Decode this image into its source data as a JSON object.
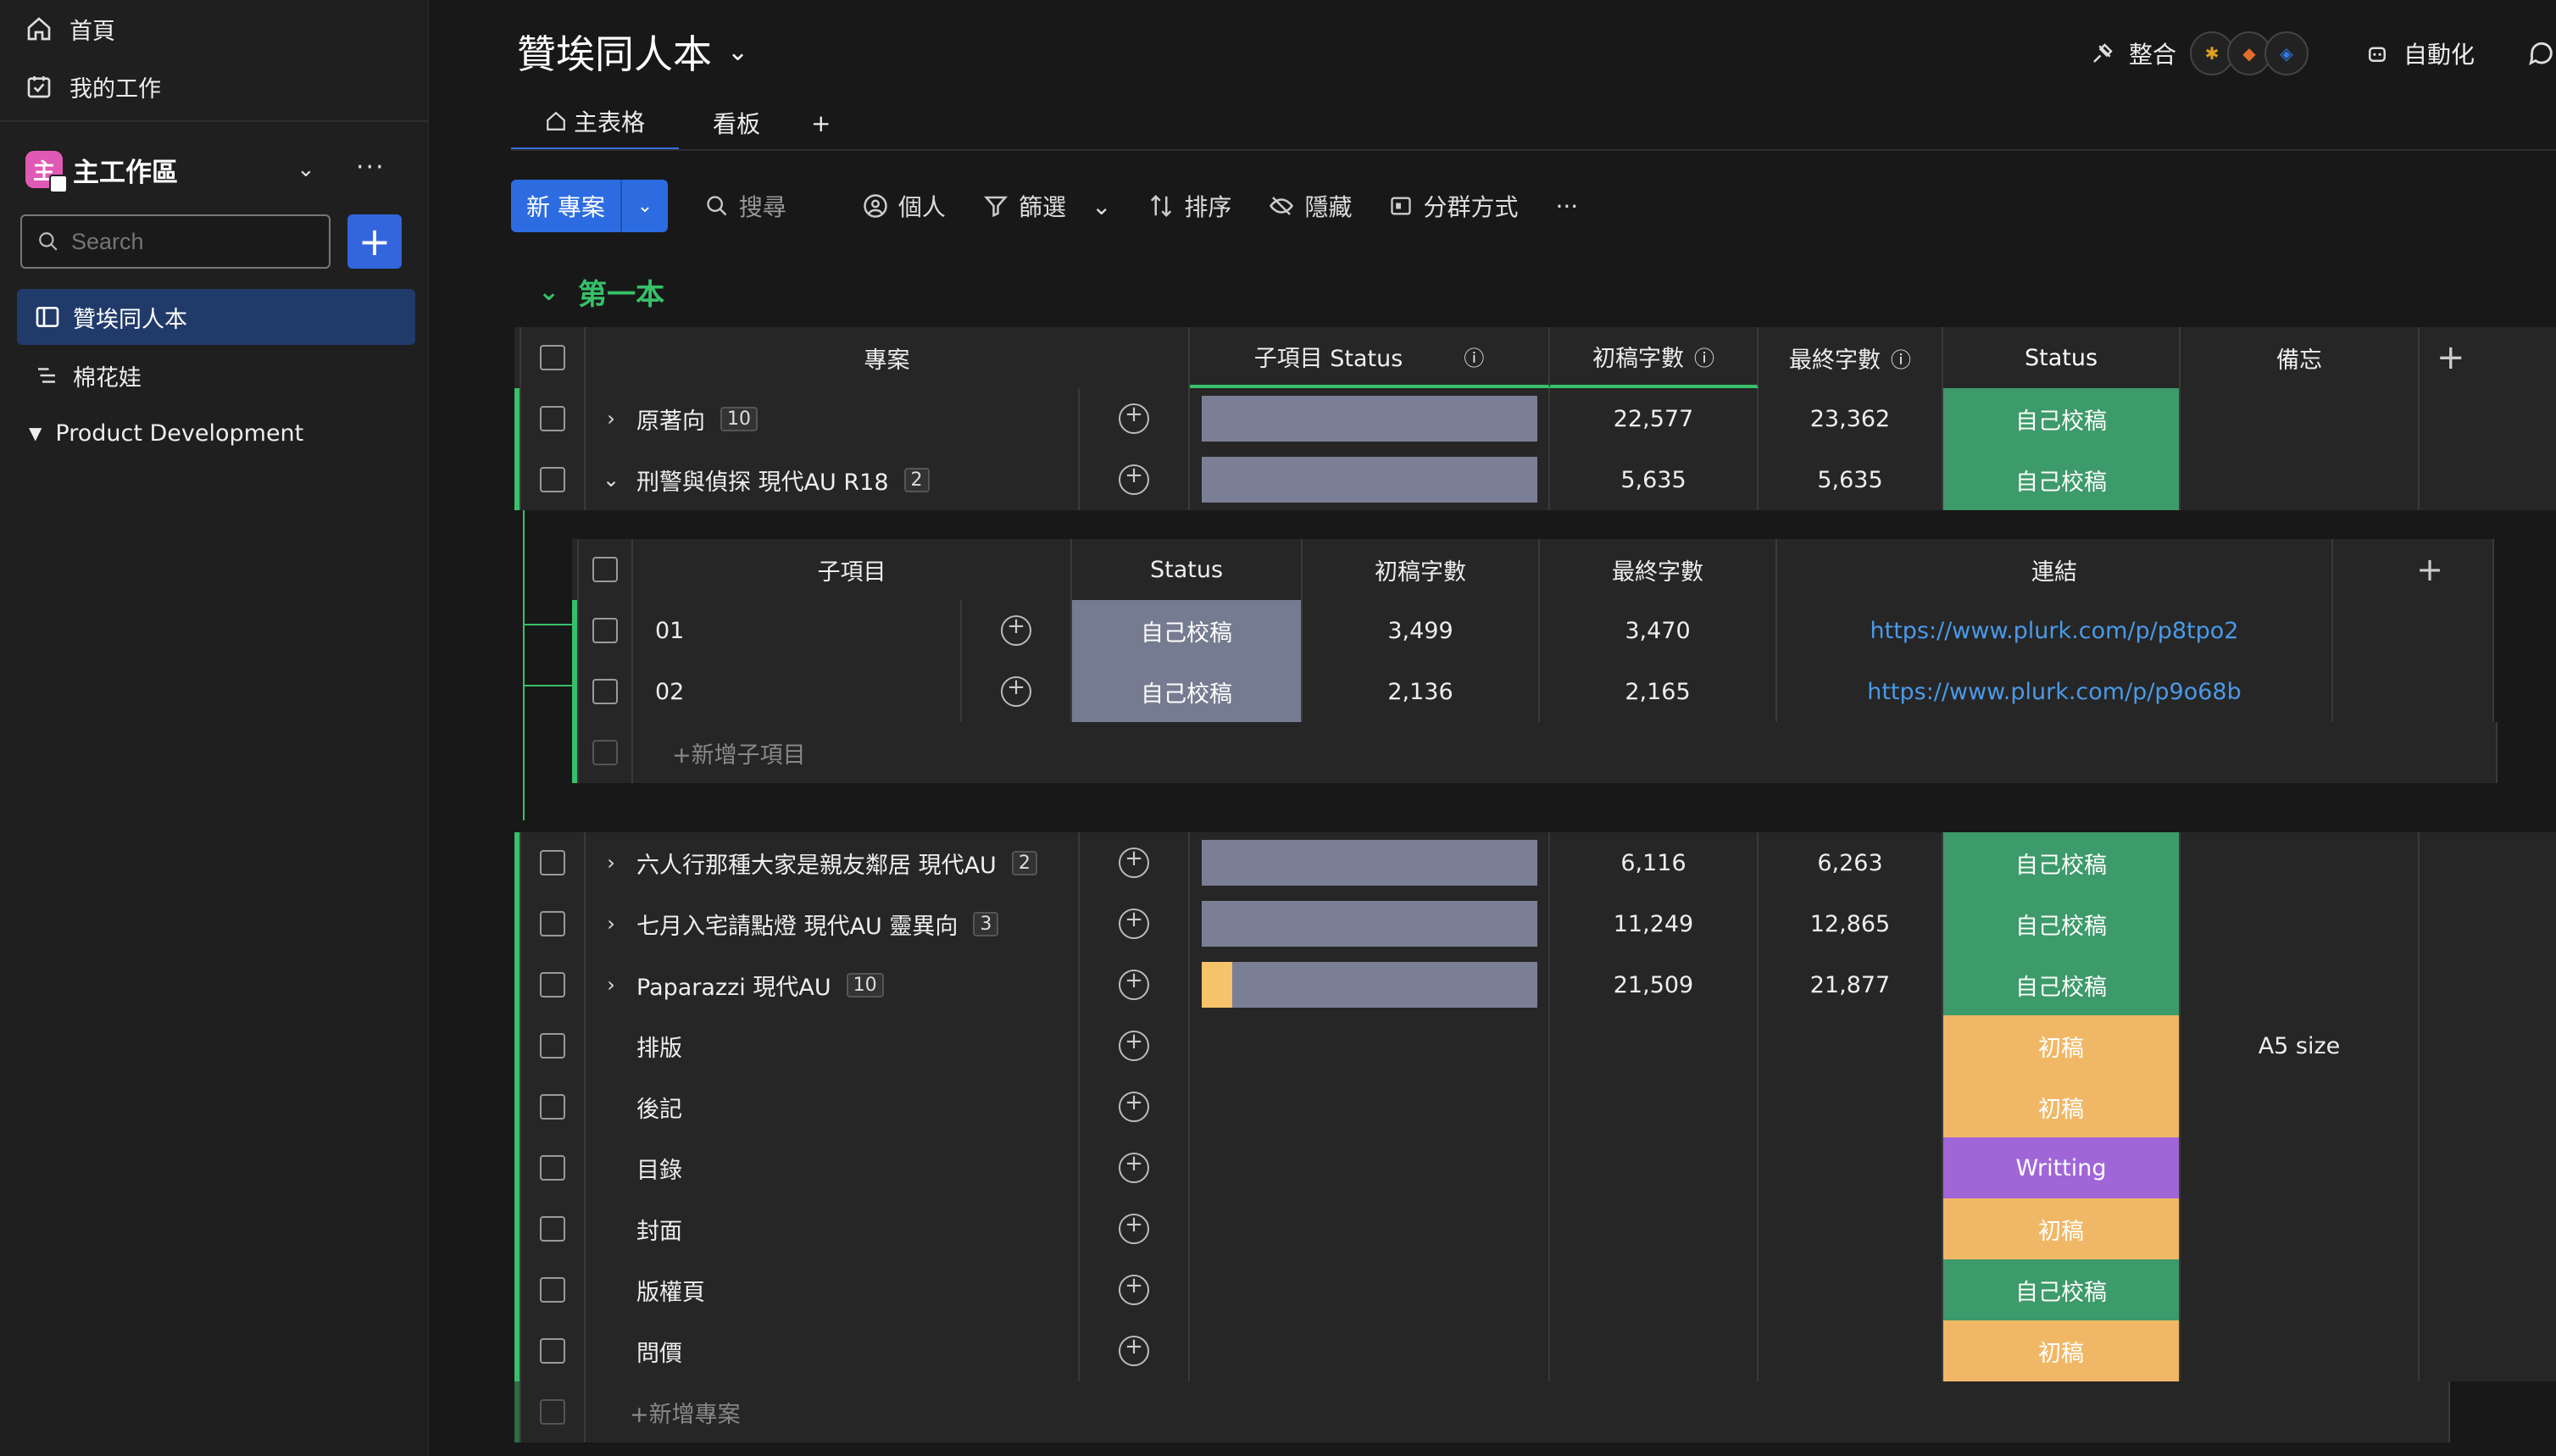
{
  "sidebar": {
    "home": "首頁",
    "my_work": "我的工作",
    "workspace_name": "主工作區",
    "workspace_logo": "主",
    "search_placeholder": "Search",
    "boards": [
      {
        "label": "贊埃同人本",
        "icon": "board-icon"
      },
      {
        "label": "棉花娃",
        "icon": "list-icon"
      },
      {
        "label": "Product Development",
        "icon": "caret-icon"
      }
    ]
  },
  "header": {
    "title": "贊埃同人本",
    "integrate": "整合",
    "automate": "自動化",
    "tabs": [
      {
        "label": "主表格"
      },
      {
        "label": "看板"
      },
      {
        "label": "+"
      }
    ]
  },
  "toolbar": {
    "new_project": "新 專案",
    "search": "搜尋",
    "person": "個人",
    "filter": "篩選",
    "sort": "排序",
    "hide": "隱藏",
    "group_by": "分群方式",
    "more": "···"
  },
  "group": {
    "title": "第一本",
    "columns": {
      "project": "專案",
      "sub_status": "子項目 Status",
      "draft": "初稿字數",
      "final": "最終字數",
      "status": "Status",
      "note": "備忘",
      "plus": "+"
    },
    "rows": [
      {
        "name": "原著向",
        "count": "10",
        "draft": "22,577",
        "final": "23,362",
        "status": "自己校稿"
      },
      {
        "name": "刑警與偵探 現代AU R18",
        "count": "2",
        "draft": "5,635",
        "final": "5,635",
        "status": "自己校稿"
      },
      {
        "name": "六人行那種大家是親友鄰居 現代AU",
        "count": "2",
        "draft": "6,116",
        "final": "6,263",
        "status": "自己校稿"
      },
      {
        "name": "七月入宅請點燈 現代AU 靈異向",
        "count": "3",
        "draft": "11,249",
        "final": "12,865",
        "status": "自己校稿"
      },
      {
        "name": "Paparazzi 現代AU",
        "count": "10",
        "draft": "21,509",
        "final": "21,877",
        "status": "自己校稿"
      },
      {
        "name": "排版",
        "status": "初稿",
        "note": "A5 size"
      },
      {
        "name": "後記",
        "status": "初稿"
      },
      {
        "name": "目錄",
        "status": "Writting"
      },
      {
        "name": "封面",
        "status": "初稿"
      },
      {
        "name": "版權頁",
        "status": "自己校稿"
      },
      {
        "name": "問價",
        "status": "初稿"
      }
    ],
    "add_project": "+新增專案"
  },
  "subitems": {
    "columns": {
      "name": "子項目",
      "status": "Status",
      "draft": "初稿字數",
      "final": "最終字數",
      "link": "連結",
      "plus": "+"
    },
    "rows": [
      {
        "name": "01",
        "status": "自己校稿",
        "draft": "3,499",
        "final": "3,470",
        "link": "https://www.plurk.com/p/p8tpo2"
      },
      {
        "name": "02",
        "status": "自己校稿",
        "draft": "2,136",
        "final": "2,165",
        "link": "https://www.plurk.com/p/p9o68b"
      }
    ],
    "add": "+新增子項目"
  }
}
